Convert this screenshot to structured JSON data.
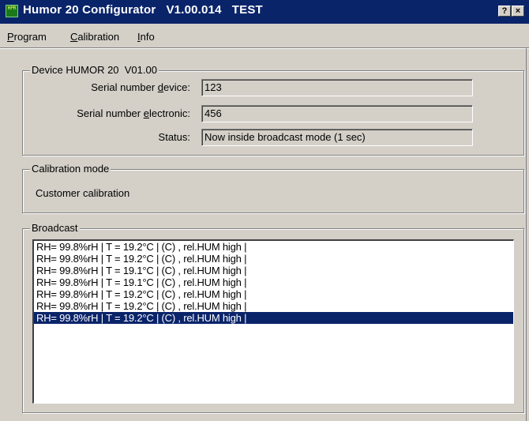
{
  "window": {
    "title": "Humor 20 Configurator   V1.00.014   TEST",
    "icon_text": "HPR",
    "help_button": "?",
    "close_button": "×"
  },
  "menu": [
    {
      "label": "Program",
      "underline": "P",
      "rest": "rogram"
    },
    {
      "label": "Calibration",
      "underline": "C",
      "rest": "alibration"
    },
    {
      "label": "Info",
      "underline": "I",
      "rest": "nfo"
    }
  ],
  "device": {
    "group_title": "Device HUMOR 20  V01.00",
    "serial_device": {
      "label_pre": "Serial number ",
      "label_u": "d",
      "label_post": "evice:",
      "value": "123"
    },
    "serial_electronic": {
      "label_pre": "Serial number ",
      "label_u": "e",
      "label_post": "lectronic:",
      "value": "456"
    },
    "status": {
      "label": "Status:",
      "value": "Now inside broadcast mode (1 sec)"
    }
  },
  "calibration": {
    "group_title": "Calibration mode",
    "value": "Customer calibration"
  },
  "broadcast": {
    "group_title": "Broadcast",
    "lines": [
      "RH= 99.8%rH | T = 19.2°C | (C) , rel.HUM high |",
      "RH= 99.8%rH | T = 19.2°C | (C) , rel.HUM high |",
      "RH= 99.8%rH | T = 19.1°C | (C) , rel.HUM high |",
      "RH= 99.8%rH | T = 19.1°C | (C) , rel.HUM high |",
      "RH= 99.8%rH | T = 19.2°C | (C) , rel.HUM high |",
      "RH= 99.8%rH | T = 19.2°C | (C) , rel.HUM high |",
      "RH= 99.8%rH | T = 19.2°C | (C) , rel.HUM high |"
    ],
    "selected_index": 6
  },
  "colors": {
    "titlebar": "#0a246a",
    "face": "#d4d0c8",
    "selection": "#0a246a"
  }
}
